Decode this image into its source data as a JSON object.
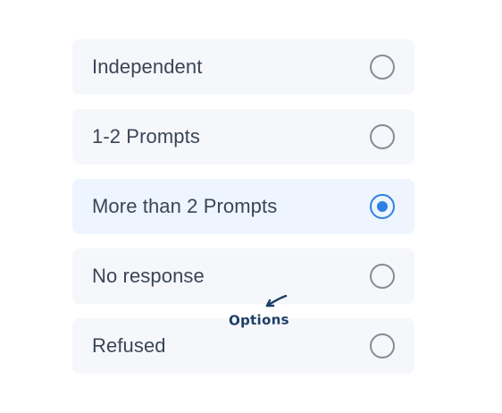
{
  "options": [
    {
      "label": "Independent",
      "selected": false
    },
    {
      "label": "1-2 Prompts",
      "selected": false
    },
    {
      "label": "More than 2 Prompts",
      "selected": true
    },
    {
      "label": "No response",
      "selected": false
    },
    {
      "label": "Refused",
      "selected": false
    }
  ],
  "annotation": {
    "text": "Options",
    "icon": "arrow-down-left-icon"
  },
  "colors": {
    "option_background": "#f5f7fb",
    "selected_background": "#eef5fe",
    "radio_border": "#868b94",
    "selected_accent": "#2f80e4",
    "label_text": "#3b4556",
    "annotation_text": "#1e3f66"
  }
}
